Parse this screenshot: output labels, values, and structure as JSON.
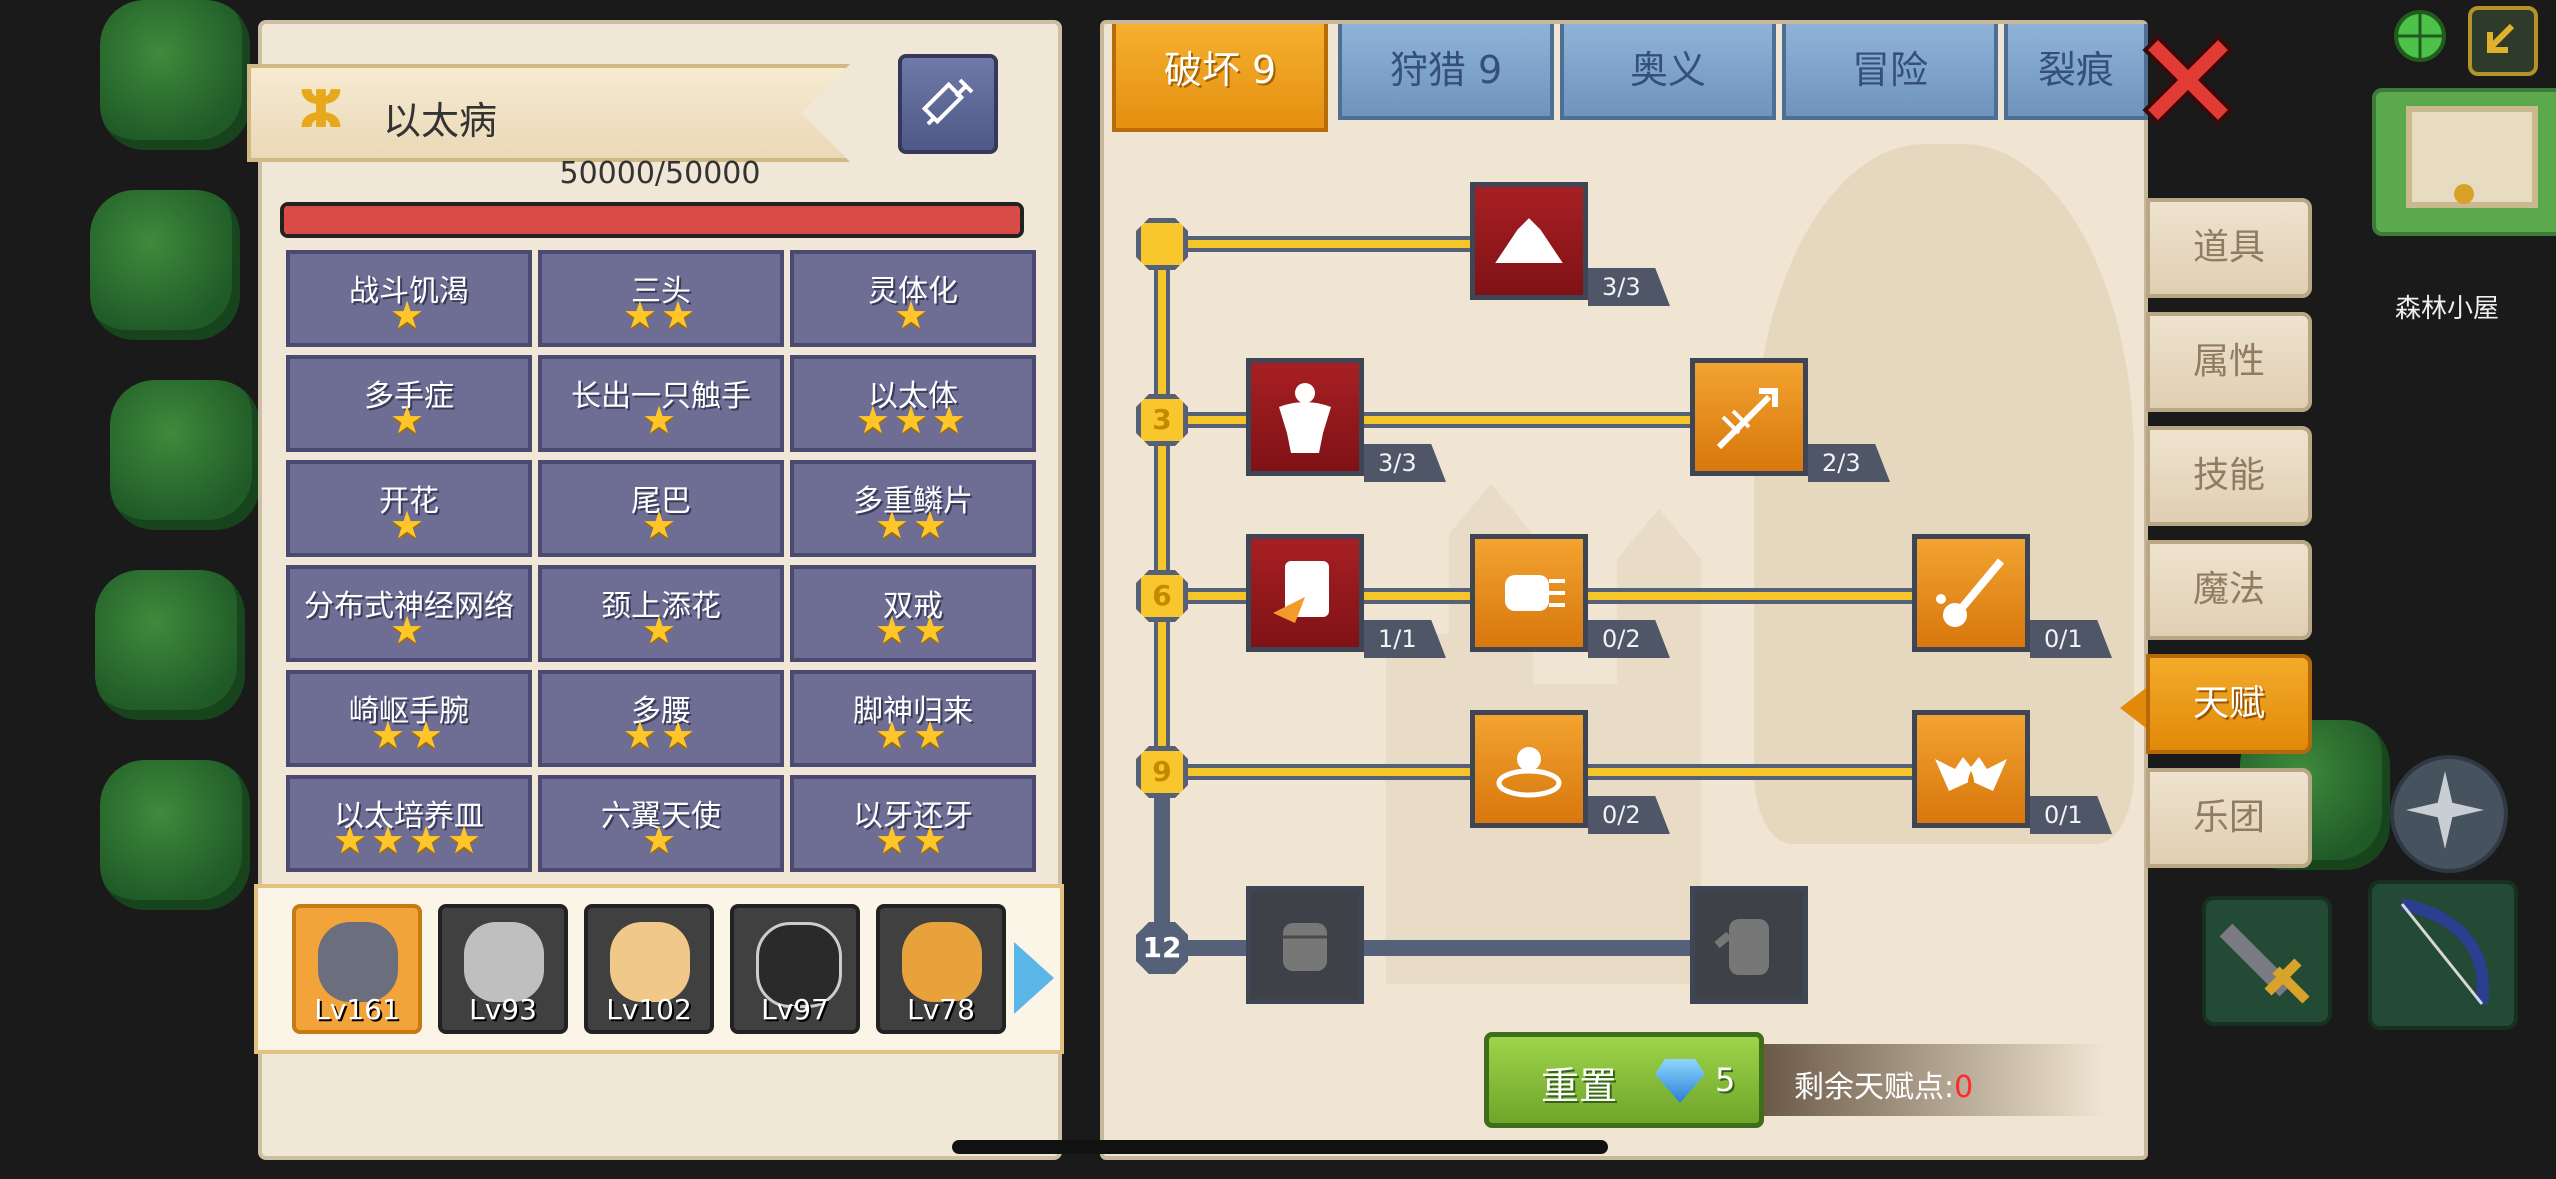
{
  "background": {
    "location_label": "森林小屋"
  },
  "disease": {
    "name": "以太病",
    "hp": "50000/50000",
    "hp_fraction": 1.0,
    "mutations": [
      {
        "name": "战斗饥渴",
        "stars": "★"
      },
      {
        "name": "三头",
        "stars": "★★"
      },
      {
        "name": "灵体化",
        "stars": "★"
      },
      {
        "name": "多手症",
        "stars": "★"
      },
      {
        "name": "长出一只触手",
        "stars": "★"
      },
      {
        "name": "以太体",
        "stars": "★★★"
      },
      {
        "name": "开花",
        "stars": "★"
      },
      {
        "name": "尾巴",
        "stars": "★"
      },
      {
        "name": "多重鳞片",
        "stars": "★★"
      },
      {
        "name": "分布式神经网络",
        "stars": "★"
      },
      {
        "name": "颈上添花",
        "stars": "★"
      },
      {
        "name": "双戒",
        "stars": "★★"
      },
      {
        "name": "崎岖手腕",
        "stars": "★★"
      },
      {
        "name": "多腰",
        "stars": "★★"
      },
      {
        "name": "脚神归来",
        "stars": "★★"
      },
      {
        "name": "以太培养皿",
        "stars": "★★★★"
      },
      {
        "name": "六翼天使",
        "stars": "★"
      },
      {
        "name": "以牙还牙",
        "stars": "★★"
      }
    ]
  },
  "heroes": [
    {
      "level": "Lv161",
      "selected": true
    },
    {
      "level": "Lv93"
    },
    {
      "level": "Lv102"
    },
    {
      "level": "Lv97"
    },
    {
      "level": "Lv78"
    }
  ],
  "talent_tabs": [
    "破坏 9",
    "狩猎 9",
    "奥义",
    "冒险",
    "裂痕"
  ],
  "talent_tree": {
    "levels": [
      "3",
      "6",
      "9",
      "12"
    ],
    "talents": [
      {
        "icon": "arm-wrestle-icon",
        "count": "3/3",
        "color": "red"
      },
      {
        "icon": "muscle-body-icon",
        "count": "3/3",
        "color": "red"
      },
      {
        "icon": "arrow-hit-icon",
        "count": "2/3",
        "color": "orange"
      },
      {
        "icon": "card-strike-icon",
        "count": "1/1",
        "color": "red"
      },
      {
        "icon": "punch-icon",
        "count": "0/2",
        "color": "orange"
      },
      {
        "icon": "splash-slash-icon",
        "count": "0/1",
        "color": "orange"
      },
      {
        "icon": "ripple-orb-icon",
        "count": "0/2",
        "color": "orange"
      },
      {
        "icon": "bat-drop-icon",
        "count": "0/1",
        "color": "orange"
      },
      {
        "icon": "fist-icon",
        "count": "",
        "color": "locked"
      },
      {
        "icon": "palm-icon",
        "count": "",
        "color": "locked"
      }
    ]
  },
  "reset": {
    "label": "重置",
    "cost": "5"
  },
  "points": {
    "label": "剩余天赋点:",
    "value": "0"
  },
  "side_tabs": [
    "道具",
    "属性",
    "技能",
    "魔法",
    "天赋",
    "乐团"
  ],
  "colors": {
    "accent": "#f2a330",
    "hp": "#d94b47",
    "points_value": "#ff2a2a"
  }
}
